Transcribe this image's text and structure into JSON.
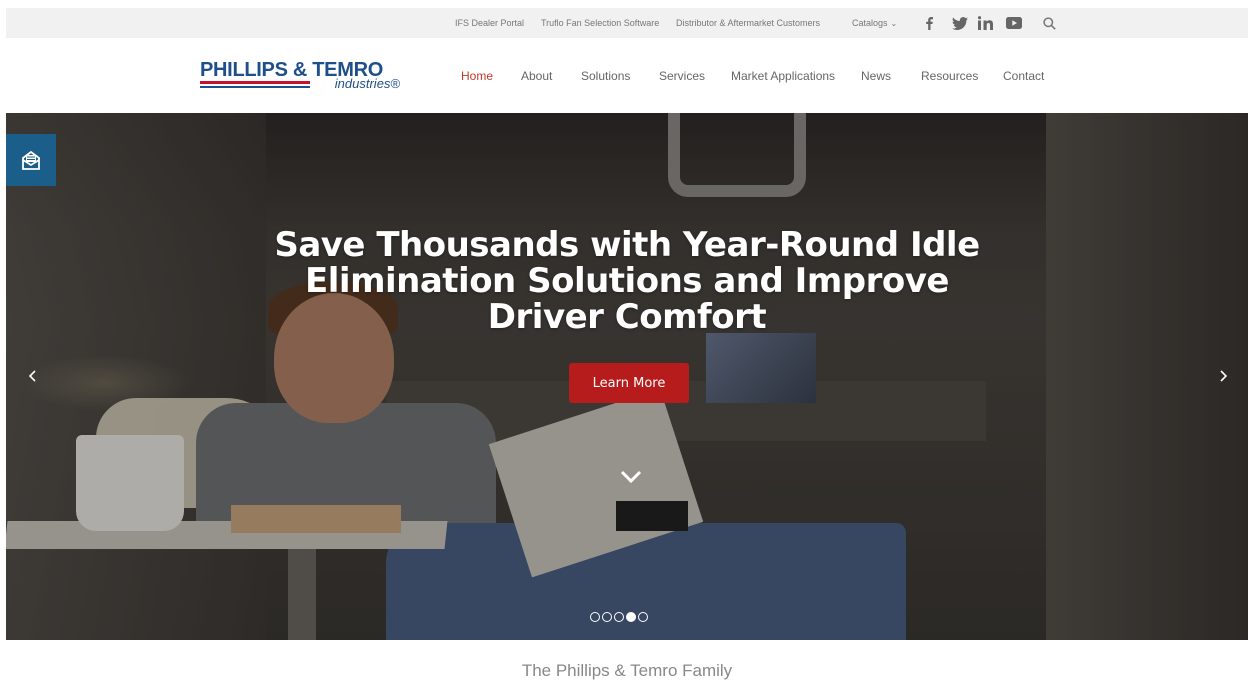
{
  "utility_bar": {
    "links": [
      {
        "label": "IFS Dealer Portal"
      },
      {
        "label": "Truflo Fan Selection Software"
      },
      {
        "label": "Distributor & Aftermarket Customers"
      },
      {
        "label": "Catalogs"
      }
    ],
    "social_icons": [
      "facebook-icon",
      "twitter-icon",
      "linkedin-icon",
      "youtube-icon",
      "search-icon"
    ]
  },
  "header": {
    "logo": {
      "main": "PHILLIPS & TEMRO",
      "sub": "industries®"
    },
    "nav": [
      {
        "label": "Home",
        "active": true
      },
      {
        "label": "About"
      },
      {
        "label": "Solutions"
      },
      {
        "label": "Services"
      },
      {
        "label": "Market Applications"
      },
      {
        "label": "News"
      },
      {
        "label": "Resources"
      },
      {
        "label": "Contact"
      }
    ]
  },
  "hero": {
    "title": "Save Thousands with Year-Round Idle Elimination Solutions and Improve Driver Comfort",
    "cta_label": "Learn More",
    "slide_count": 5,
    "active_slide": 4
  },
  "below": {
    "text": "The Phillips & Temro Family"
  },
  "colors": {
    "accent_red": "#b71c1c",
    "nav_active": "#c0392b",
    "brand_blue": "#1f4f8a",
    "side_tab": "#1b5e8a"
  }
}
